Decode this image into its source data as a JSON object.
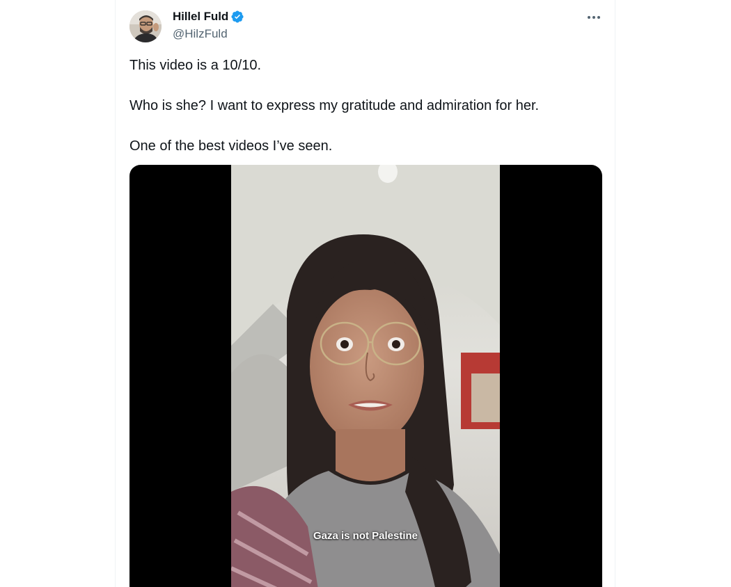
{
  "author": {
    "display_name": "Hillel Fuld",
    "handle": "@HilzFuld",
    "verified": true,
    "verified_icon": "verified-badge-icon",
    "avatar": "avatar-photo"
  },
  "more_icon": "more-horizontal-icon",
  "tweet": {
    "paragraphs": [
      "This video is a 10/10.",
      "Who is she? I want to express my gratitude and admiration for her.",
      "One of the best videos I’ve seen."
    ]
  },
  "video": {
    "caption": "Gaza is not Palestine"
  },
  "colors": {
    "text_primary": "#0f1419",
    "text_secondary": "#536471",
    "verified_blue": "#1d9bf0",
    "video_background": "#000000"
  }
}
